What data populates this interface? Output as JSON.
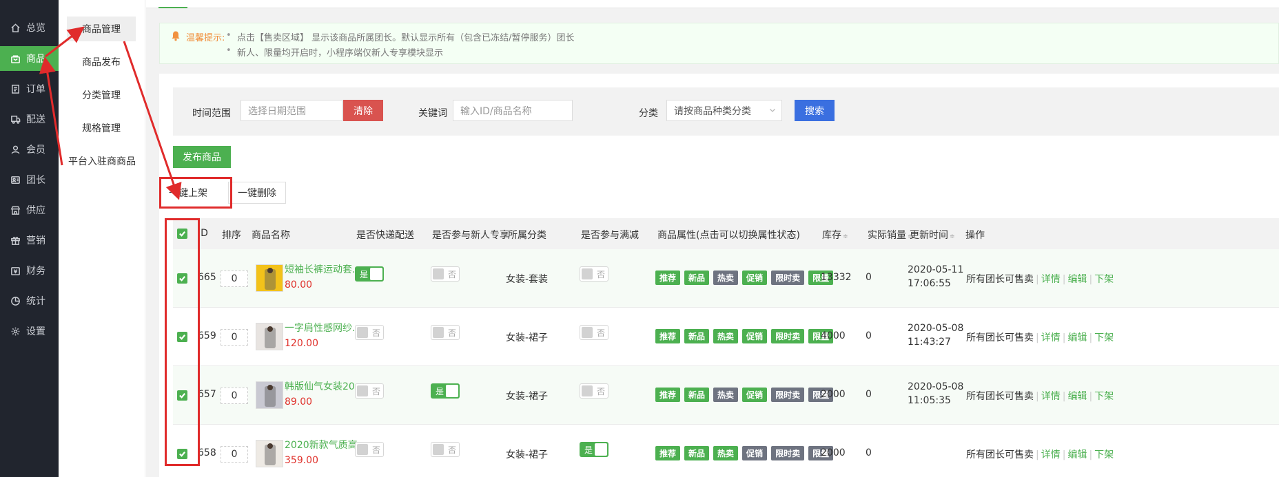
{
  "sidebar": {
    "items": [
      {
        "label": "总览",
        "icon": "home-icon"
      },
      {
        "label": "商品",
        "icon": "bag-icon",
        "active": true
      },
      {
        "label": "订单",
        "icon": "order-icon"
      },
      {
        "label": "配送",
        "icon": "delivery-icon"
      },
      {
        "label": "会员",
        "icon": "user-icon"
      },
      {
        "label": "团长",
        "icon": "leader-icon"
      },
      {
        "label": "供应",
        "icon": "store-icon"
      },
      {
        "label": "营销",
        "icon": "gift-icon"
      },
      {
        "label": "财务",
        "icon": "finance-icon"
      },
      {
        "label": "统计",
        "icon": "chart-icon"
      },
      {
        "label": "设置",
        "icon": "gear-icon"
      }
    ]
  },
  "submenu": {
    "items": [
      {
        "label": "商品管理",
        "active": true
      },
      {
        "label": "商品发布"
      },
      {
        "label": "分类管理"
      },
      {
        "label": "规格管理"
      },
      {
        "label": "平台入驻商商品"
      }
    ]
  },
  "tips": {
    "title": "温馨提示:",
    "line1": "点击【售卖区域】 显示该商品所属团长。默认显示所有（包含已冻结/暂停服务）团长",
    "line2": "新人、限量均开启时，小程序端仅新人专享模块显示"
  },
  "filter": {
    "time_label": "时间范围",
    "time_placeholder": "选择日期范围",
    "clear_label": "清除",
    "keyword_label": "关键词",
    "keyword_placeholder": "输入ID/商品名称",
    "category_label": "分类",
    "category_placeholder": "请按商品种类分类",
    "search_label": "搜索"
  },
  "actions": {
    "publish_label": "发布商品",
    "bulk_on_label": "一键上架",
    "bulk_delete_label": "一键删除"
  },
  "table": {
    "headers": {
      "id": "ID",
      "sort": "排序",
      "name": "商品名称",
      "express": "是否快递配送",
      "newuser": "是否参与新人专享",
      "category": "所属分类",
      "discount": "是否参与满减",
      "attrs": "商品属性(点击可以切换属性状态)",
      "stock": "库存",
      "sales": "实际销量",
      "updated": "更新时间",
      "ops": "操作"
    },
    "sort_glyph": "≑",
    "toggle_on": "是",
    "toggle_off": "否",
    "tag_labels": [
      "推荐",
      "新品",
      "热卖",
      "促销",
      "限时卖",
      "限量"
    ],
    "op_labels": {
      "sellers": "所有团长可售卖",
      "detail": "详情",
      "edit": "编辑",
      "offshelf": "下架"
    },
    "rows": [
      {
        "id": "665",
        "sort": "0",
        "name": "短袖长裤运动套...",
        "price": "80.00",
        "express": true,
        "newuser": false,
        "category": "女装-套装",
        "discount": false,
        "tags_on": [
          true,
          true,
          false,
          true,
          false,
          true
        ],
        "stock": "13332",
        "sales": "0",
        "date": "2020-05-11",
        "time": "17:06:55"
      },
      {
        "id": "659",
        "sort": "0",
        "name": "一字肩性感网纱...",
        "price": "120.00",
        "express": false,
        "newuser": false,
        "category": "女装-裙子",
        "discount": false,
        "tags_on": [
          true,
          true,
          true,
          true,
          true,
          true
        ],
        "stock": "4000",
        "sales": "0",
        "date": "2020-05-08",
        "time": "11:43:27"
      },
      {
        "id": "657",
        "sort": "0",
        "name": "韩版仙气女装20...",
        "price": "89.00",
        "express": false,
        "newuser": true,
        "category": "女装-裙子",
        "discount": false,
        "tags_on": [
          true,
          true,
          false,
          true,
          false,
          false
        ],
        "stock": "2000",
        "sales": "0",
        "date": "2020-05-08",
        "time": "11:05:35"
      },
      {
        "id": "658",
        "sort": "0",
        "name": "2020新款气质高...",
        "price": "359.00",
        "express": false,
        "newuser": false,
        "category": "女装-裙子",
        "discount": true,
        "tags_on": [
          true,
          true,
          true,
          false,
          false,
          false
        ],
        "stock": "2000",
        "sales": "0",
        "date": "",
        "time": ""
      }
    ]
  }
}
